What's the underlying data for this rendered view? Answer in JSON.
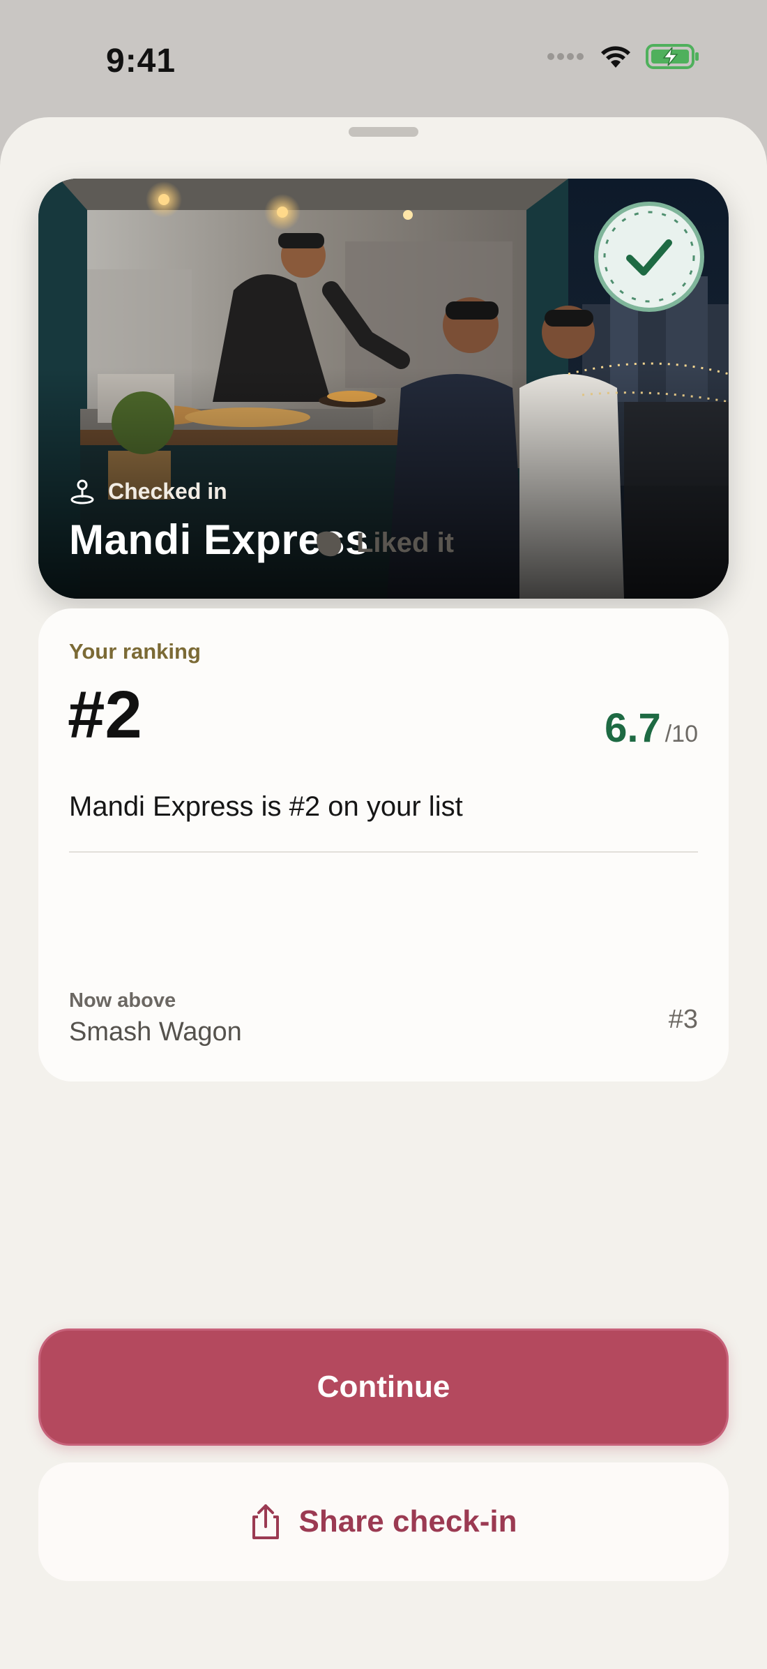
{
  "status_bar": {
    "time": "9:41"
  },
  "hero": {
    "status_label": "Checked in",
    "place_name": "Mandi Express",
    "icon": "pin-icon",
    "badge_icon": "check-badge-icon"
  },
  "reaction": {
    "label": "Liked it",
    "icon": "liked-blob-icon"
  },
  "ranking": {
    "eyebrow": "Your ranking",
    "rank": "#2",
    "score": "6.7",
    "score_max": "/10",
    "summary": "Mandi Express is #2 on your list",
    "now_above_label": "Now above",
    "now_above_name": "Smash Wagon",
    "now_above_rank": "#3"
  },
  "actions": {
    "continue_label": "Continue",
    "share_label": "Share check-in",
    "share_icon": "share-icon"
  },
  "colors": {
    "accent": "#b4495e",
    "score_green": "#1e6a43",
    "eyebrow_gold": "#7b6a35",
    "sheet_bg": "#f3f1ec"
  }
}
